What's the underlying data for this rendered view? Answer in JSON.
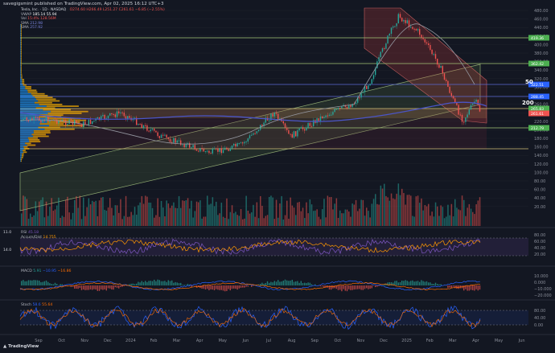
{
  "header": {
    "published": "savegigsmint published on TradingView.com, Apr 02, 2025 16:12 UTC+3"
  },
  "legend": {
    "title": "Tesla, Inc. · 1D · NASDAQ",
    "ohlc": "O274.60 H266.49 L251.27 C261.61 −6.85 (−2.55%)",
    "lines": [
      {
        "label": "VWAP",
        "value": "185.14 55.94",
        "color": "#ffffff"
      },
      {
        "label": "Vol",
        "value": "15:4% 128.56M",
        "color": "#ef5350"
      },
      {
        "label": "SMA",
        "value": "212.98",
        "color": "#5b6bd6"
      },
      {
        "label": "SMA",
        "value": "257.92",
        "color": "#5b6bd6"
      }
    ]
  },
  "price_axis": [
    "480.00",
    "460.00",
    "440.00",
    "420.00",
    "400.00",
    "380.00",
    "360.00",
    "340.00",
    "320.00",
    "300.00",
    "280.00",
    "260.00",
    "240.00",
    "220.00",
    "200.00",
    "180.00",
    "160.00",
    "140.00",
    "120.00",
    "100.00",
    "80.00",
    "60.00",
    "40.00",
    "20.00"
  ],
  "price_tags": [
    {
      "text": "419.36",
      "color": "#4caf50"
    },
    {
      "text": "362.42",
      "color": "#4caf50"
    },
    {
      "text": "322.51",
      "color": "#2962ff"
    },
    {
      "text": "288.45",
      "color": "#2962ff"
    },
    {
      "text": "265.83",
      "color": "#4caf50"
    },
    {
      "text": "261.61",
      "color": "#ef5350"
    },
    {
      "text": "212.79",
      "color": "#4caf50"
    }
  ],
  "big_labels": {
    "a": "50",
    "b": "200"
  },
  "time_axis": [
    "Sep",
    "Oct",
    "Nov",
    "Dec",
    "2024",
    "Feb",
    "Mar",
    "Apr",
    "May",
    "Jun",
    "Jul",
    "Aug",
    "Sep",
    "Oct",
    "Nov",
    "Dec",
    "2025",
    "Feb",
    "Mar",
    "Apr",
    "May",
    "Jun"
  ],
  "rsi": {
    "label": "RSI",
    "value": "45.18",
    "ad_label": "Accum/Dist",
    "ad_value": "14.755",
    "left_top": "11.0",
    "left_bot": "14.0",
    "axis": [
      "80.00",
      "60.00",
      "40.00",
      "20.00"
    ]
  },
  "macd": {
    "label": "MACD",
    "v1": "5.91",
    "v2": "−10.95",
    "v3": "−16.86",
    "axis": [
      "10.000",
      "0.000",
      "−10.000",
      "−20.000"
    ]
  },
  "stoch": {
    "label": "Stoch",
    "v1": "58.6",
    "v2": "55.64",
    "axis": [
      "80.00",
      "40.00",
      "0.00"
    ]
  },
  "logo": {
    "text": "TradingView"
  },
  "colors": {
    "bg": "#131722",
    "up": "#26a69a",
    "down": "#ef5350",
    "channel_red": "#b23b3b",
    "channel_green": "#5c7a45",
    "grid": "#2a2e39"
  }
}
